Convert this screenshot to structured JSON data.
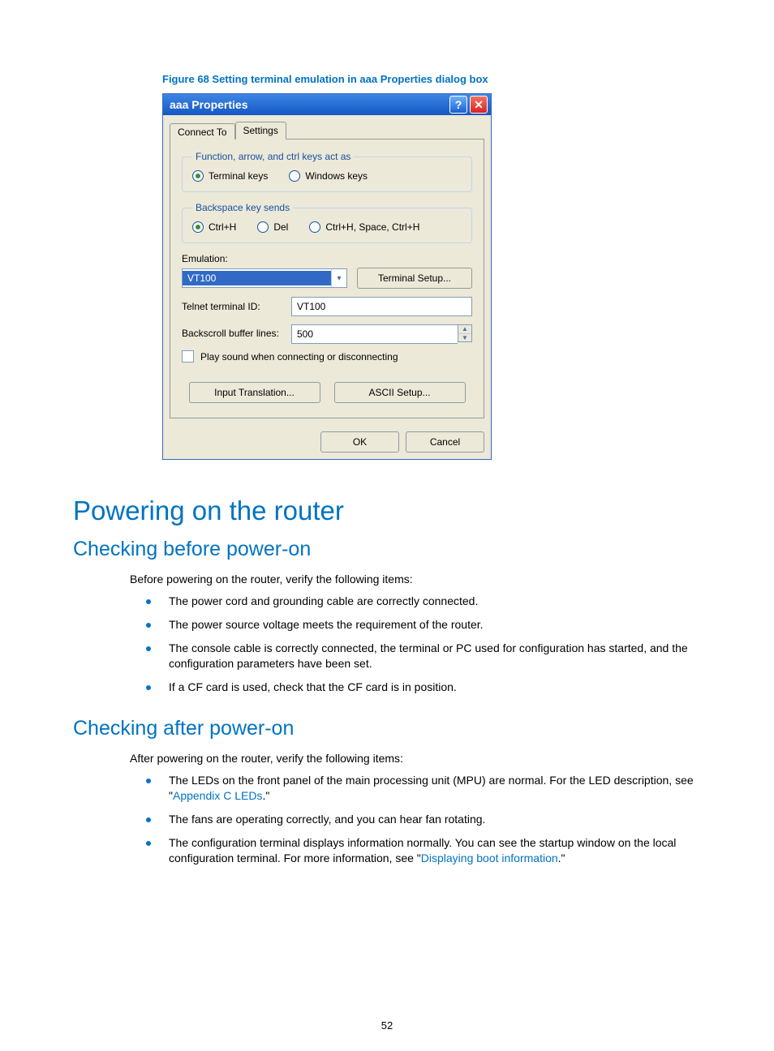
{
  "figure_caption": "Figure 68 Setting terminal emulation in aaa Properties dialog box",
  "dialog": {
    "title": "aaa Properties",
    "help": "?",
    "close": "✕",
    "tabs": {
      "connect": "Connect To",
      "settings": "Settings"
    },
    "group1_legend": "Function, arrow, and ctrl keys act as",
    "radio_terminal": "Terminal keys",
    "radio_windows": "Windows keys",
    "group2_legend": "Backspace key sends",
    "radio_ctrlh": "Ctrl+H",
    "radio_del": "Del",
    "radio_ctrlh_space": "Ctrl+H, Space, Ctrl+H",
    "emulation_label": "Emulation:",
    "emulation_value": "VT100",
    "terminal_setup_btn": "Terminal Setup...",
    "telnet_label": "Telnet terminal ID:",
    "telnet_value": "VT100",
    "backscroll_label": "Backscroll buffer lines:",
    "backscroll_value": "500",
    "play_sound_label": "Play sound when connecting or disconnecting",
    "input_translation_btn": "Input Translation...",
    "ascii_setup_btn": "ASCII Setup...",
    "ok_btn": "OK",
    "cancel_btn": "Cancel"
  },
  "h1": "Powering on the router",
  "h2a": "Checking before power-on",
  "before_para": "Before powering on the router, verify the following items:",
  "before_items": [
    "The power cord and grounding cable are correctly connected.",
    "The power source voltage meets the requirement of the router.",
    "The console cable is correctly connected, the terminal or PC used for configuration has started, and the configuration parameters have been set.",
    "If a CF card is used, check that the CF card is in position."
  ],
  "h2b": "Checking after power-on",
  "after_para": "After powering on the router, verify the following items:",
  "after_item1_lead": "The LEDs on the front panel of the main processing unit (MPU) are normal. For the LED description, see \"",
  "after_item1_link": "Appendix C LEDs",
  "after_item1_tail": ".\"",
  "after_item2": "The fans are operating correctly, and you can hear fan rotating.",
  "after_item3_lead": "The configuration terminal displays information normally. You can see the startup window on the local configuration terminal. For more information, see \"",
  "after_item3_link": "Displaying boot information",
  "after_item3_tail": ".\"",
  "page_number": "52"
}
